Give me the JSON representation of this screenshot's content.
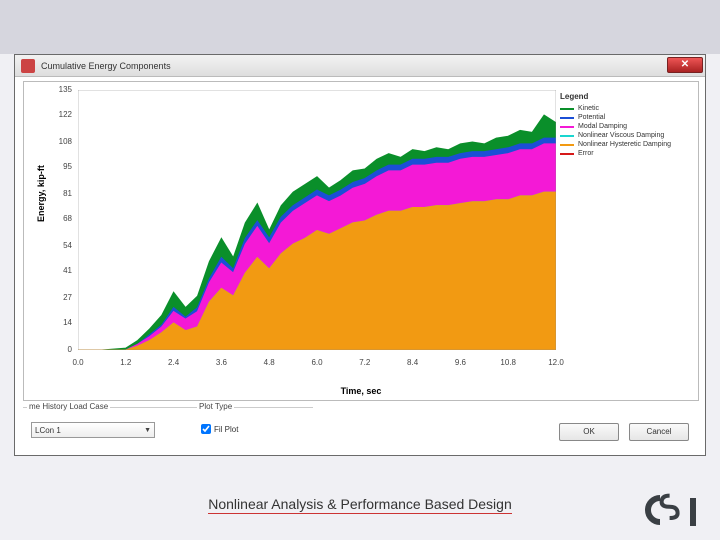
{
  "window_title": "Cumulative Energy Components",
  "legend": {
    "header": "Legend",
    "items": [
      {
        "label": "Kinetic",
        "color": "#0a8f2a"
      },
      {
        "label": "Potential",
        "color": "#1b4fd6"
      },
      {
        "label": "Modal Damping",
        "color": "#f419d6"
      },
      {
        "label": "Nonlinear Viscous Damping",
        "color": "#19d6d0"
      },
      {
        "label": "Nonlinear Hysteretic Damping",
        "color": "#f29a12"
      },
      {
        "label": "Error",
        "color": "#d61919"
      }
    ]
  },
  "controls": {
    "load_case_label": "me History Load Case",
    "load_case_value": "LCon 1",
    "plot_type_label": "Plot Type",
    "fill_label": "Fil Plot",
    "fill_checked": true,
    "ok": "OK",
    "cancel": "Cancel"
  },
  "footer_text": "Nonlinear Analysis & Performance Based Design",
  "chart_data": {
    "type": "area",
    "title": "",
    "xlabel": "Time, sec",
    "ylabel": "Energy, kip-ft",
    "xlim": [
      0,
      12.0
    ],
    "ylim": [
      0,
      135
    ],
    "xticks": [
      0.0,
      1.2,
      2.4,
      3.6,
      4.8,
      6.0,
      7.2,
      8.4,
      9.6,
      10.8,
      12.0
    ],
    "yticks": [
      0,
      14,
      27,
      41,
      54,
      68,
      81,
      95,
      108,
      122,
      135
    ],
    "x": [
      0.0,
      0.6,
      1.2,
      1.5,
      1.8,
      2.1,
      2.4,
      2.7,
      3.0,
      3.3,
      3.6,
      3.9,
      4.2,
      4.5,
      4.8,
      5.1,
      5.4,
      5.7,
      6.0,
      6.3,
      6.6,
      6.9,
      7.2,
      7.5,
      7.8,
      8.1,
      8.4,
      8.7,
      9.0,
      9.3,
      9.6,
      9.9,
      10.2,
      10.5,
      10.8,
      11.1,
      11.4,
      11.7,
      12.0
    ],
    "series": [
      {
        "name": "Nonlinear Hysteretic Damping",
        "color": "#f29a12",
        "values": [
          0,
          0,
          0,
          2,
          5,
          9,
          14,
          10,
          12,
          25,
          32,
          28,
          40,
          48,
          42,
          50,
          55,
          58,
          62,
          60,
          63,
          66,
          67,
          70,
          72,
          72,
          74,
          74,
          75,
          75,
          76,
          77,
          77,
          78,
          78,
          80,
          80,
          82,
          82
        ]
      },
      {
        "name": "Nonlinear Viscous Damping",
        "color": "#19d6d0",
        "values": [
          0,
          0,
          0,
          2,
          5,
          9,
          14,
          10,
          12,
          25,
          32,
          28,
          40,
          48,
          42,
          50,
          55,
          58,
          62,
          60,
          63,
          66,
          67,
          70,
          72,
          72,
          74,
          74,
          75,
          75,
          76,
          77,
          77,
          78,
          78,
          80,
          80,
          82,
          82
        ]
      },
      {
        "name": "Modal Damping",
        "color": "#f419d6",
        "values": [
          0,
          0,
          0,
          3,
          7,
          12,
          20,
          16,
          20,
          35,
          45,
          40,
          55,
          64,
          55,
          66,
          72,
          76,
          80,
          77,
          80,
          84,
          86,
          90,
          93,
          93,
          96,
          96,
          97,
          97,
          99,
          100,
          100,
          101,
          102,
          104,
          104,
          107,
          107
        ]
      },
      {
        "name": "Potential",
        "color": "#1b4fd6",
        "values": [
          0,
          0,
          0,
          3,
          8,
          13,
          22,
          17,
          22,
          37,
          48,
          42,
          58,
          67,
          58,
          69,
          75,
          79,
          83,
          80,
          83,
          87,
          89,
          93,
          96,
          96,
          99,
          99,
          100,
          100,
          102,
          103,
          103,
          104,
          105,
          107,
          107,
          110,
          110
        ]
      },
      {
        "name": "Kinetic",
        "color": "#0a8f2a",
        "values": [
          0,
          0,
          1,
          5,
          11,
          18,
          30,
          22,
          28,
          46,
          58,
          48,
          66,
          76,
          62,
          75,
          82,
          86,
          90,
          84,
          88,
          93,
          94,
          99,
          102,
          100,
          104,
          103,
          105,
          104,
          107,
          108,
          107,
          110,
          111,
          114,
          113,
          122,
          118
        ]
      }
    ]
  }
}
